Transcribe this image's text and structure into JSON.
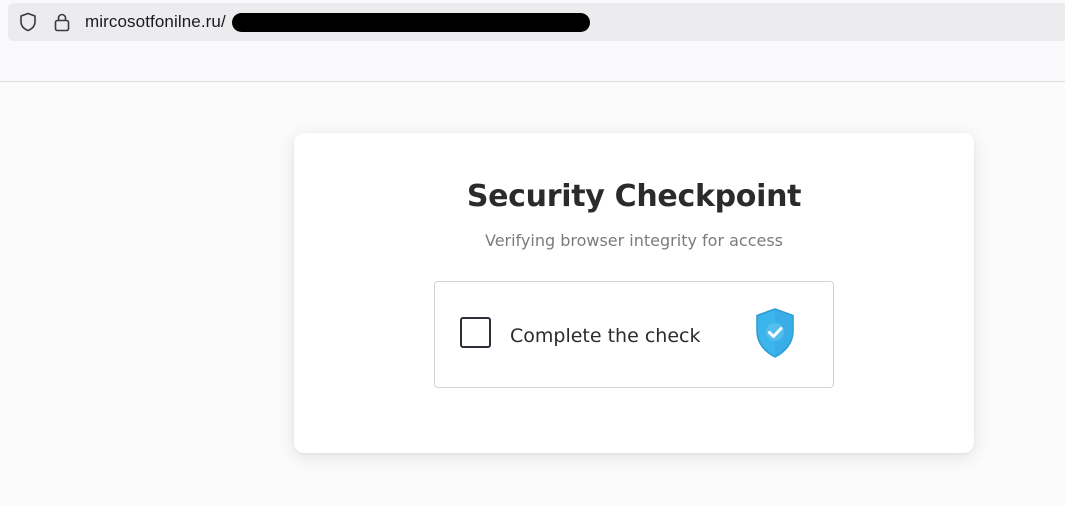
{
  "browser": {
    "url_visible": "mircosotfonilne.ru/",
    "icons": [
      "shield-icon",
      "lock-icon"
    ]
  },
  "checkpoint": {
    "title": "Security Checkpoint",
    "subtitle": "Verifying browser integrity for access",
    "checkbox_label": "Complete the check",
    "checkbox_checked": false,
    "badge_icon": "shield-check-icon"
  },
  "colors": {
    "shield_blue": "#3cb4ec",
    "text_dark": "#2b2b2b",
    "text_muted": "#7b7b7b"
  }
}
